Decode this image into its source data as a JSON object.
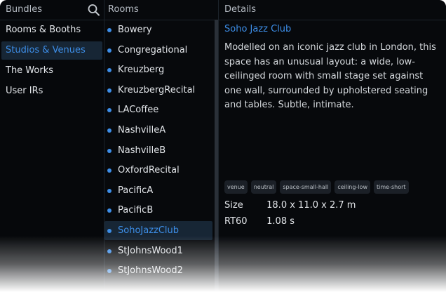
{
  "bundles": {
    "header": "Bundles",
    "items": [
      {
        "label": "Rooms & Booths",
        "selected": false
      },
      {
        "label": "Studios & Venues",
        "selected": true
      },
      {
        "label": "The Works",
        "selected": false
      },
      {
        "label": "User IRs",
        "selected": false
      }
    ]
  },
  "rooms": {
    "header": "Rooms",
    "items": [
      {
        "label": "Bowery"
      },
      {
        "label": "Congregational"
      },
      {
        "label": "Kreuzberg"
      },
      {
        "label": "KreuzbergRecital"
      },
      {
        "label": "LACoffee"
      },
      {
        "label": "NashvilleA"
      },
      {
        "label": "NashvilleB"
      },
      {
        "label": "OxfordRecital"
      },
      {
        "label": "PacificA"
      },
      {
        "label": "PacificB"
      },
      {
        "label": "SohoJazzClub",
        "selected": true
      },
      {
        "label": "StJohnsWood1"
      },
      {
        "label": "StJohnsWood2"
      }
    ]
  },
  "details": {
    "header": "Details",
    "title": "Soho Jazz Club",
    "description": "Modelled on an iconic jazz club in London, this space has an unusual layout: a wide, low-ceilinged room with small stage set against one wall, surrounded by upholstered seating and tables. Subtle, intimate.",
    "tags": [
      "venue",
      "neutral",
      "space-small-hall",
      "ceiling-low",
      "time-short"
    ],
    "size_label": "Size",
    "size_value": "18.0 x 11.0 x 2.7 m",
    "rt60_label": "RT60",
    "rt60_value": "1.08 s"
  },
  "colors": {
    "accent": "#3d8ee8",
    "selected_bg": "#172635",
    "text": "#e3e6ea"
  },
  "icons": {
    "search": "search-icon",
    "bullet": "bullet-dot-icon"
  }
}
